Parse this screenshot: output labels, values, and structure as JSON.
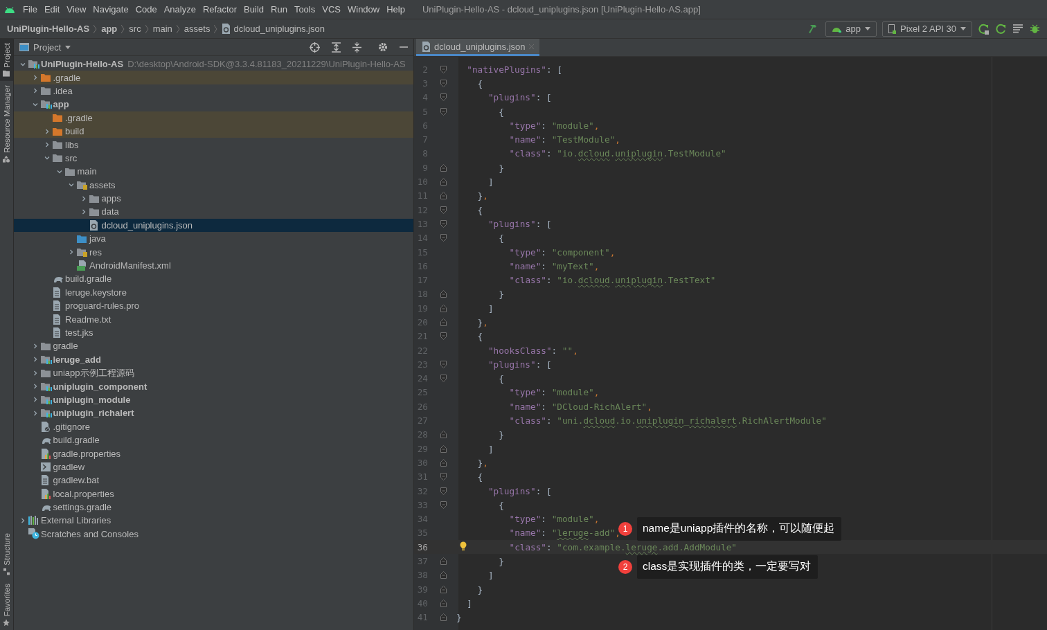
{
  "menu_bar": {
    "items": [
      "File",
      "Edit",
      "View",
      "Navigate",
      "Code",
      "Analyze",
      "Refactor",
      "Build",
      "Run",
      "Tools",
      "VCS",
      "Window",
      "Help"
    ],
    "title": "UniPlugin-Hello-AS - dcloud_uniplugins.json [UniPlugin-Hello-AS.app]"
  },
  "nav_bar": {
    "breadcrumbs": [
      {
        "label": "UniPlugin-Hello-AS",
        "bold": true,
        "kind": "text"
      },
      {
        "label": "app",
        "bold": true,
        "kind": "text"
      },
      {
        "label": "src",
        "bold": false,
        "kind": "text"
      },
      {
        "label": "main",
        "bold": false,
        "kind": "text"
      },
      {
        "label": "assets",
        "bold": false,
        "kind": "text"
      },
      {
        "label": "dcloud_uniplugins.json",
        "bold": false,
        "kind": "json"
      }
    ],
    "run_config": "app",
    "device": "Pixel 2 API 30"
  },
  "side_strip": {
    "top": [
      {
        "label": "Project",
        "selected": true
      },
      {
        "label": "Resource Manager",
        "selected": false
      }
    ],
    "bottom": [
      {
        "label": "Structure",
        "selected": false
      },
      {
        "label": "Favorites",
        "selected": false
      }
    ]
  },
  "project_panel": {
    "title": "Project",
    "tree": [
      {
        "label": "UniPlugin-Hello-AS",
        "path": "D:\\desktop\\Android-SDK@3.3.4.81183_20211229\\UniPlugin-Hello-AS",
        "kind": "module",
        "bold": true,
        "excluded": false,
        "selected": false,
        "expanded": true,
        "children": [
          {
            "label": ".gradle",
            "kind": "folder_excluded",
            "bold": false,
            "excluded": true,
            "selected": false,
            "expanded": false
          },
          {
            "label": ".idea",
            "kind": "folder",
            "bold": false,
            "excluded": false,
            "selected": false,
            "expanded": false
          },
          {
            "label": "app",
            "kind": "module",
            "bold": true,
            "excluded": false,
            "selected": false,
            "expanded": true,
            "children": [
              {
                "label": ".gradle",
                "kind": "folder_excluded",
                "bold": false,
                "excluded": true,
                "selected": false
              },
              {
                "label": "build",
                "kind": "folder_excluded",
                "bold": false,
                "excluded": true,
                "selected": false,
                "expanded": false
              },
              {
                "label": "libs",
                "kind": "folder",
                "bold": false,
                "excluded": false,
                "selected": false,
                "expanded": false
              },
              {
                "label": "src",
                "kind": "folder",
                "bold": false,
                "excluded": false,
                "selected": false,
                "expanded": true,
                "children": [
                  {
                    "label": "main",
                    "kind": "folder",
                    "bold": false,
                    "excluded": false,
                    "selected": false,
                    "expanded": true,
                    "children": [
                      {
                        "label": "assets",
                        "kind": "assets",
                        "bold": false,
                        "excluded": false,
                        "selected": false,
                        "expanded": true,
                        "children": [
                          {
                            "label": "apps",
                            "kind": "folder",
                            "bold": false,
                            "excluded": false,
                            "selected": false,
                            "expanded": false
                          },
                          {
                            "label": "data",
                            "kind": "folder",
                            "bold": false,
                            "excluded": false,
                            "selected": false,
                            "expanded": false
                          },
                          {
                            "label": "dcloud_uniplugins.json",
                            "kind": "json",
                            "bold": false,
                            "excluded": false,
                            "selected": true
                          }
                        ]
                      },
                      {
                        "label": "java",
                        "kind": "java",
                        "bold": false,
                        "excluded": false,
                        "selected": false
                      },
                      {
                        "label": "res",
                        "kind": "assets",
                        "bold": false,
                        "excluded": false,
                        "selected": false,
                        "expanded": false
                      },
                      {
                        "label": "AndroidManifest.xml",
                        "kind": "manifest",
                        "bold": false,
                        "excluded": false,
                        "selected": false
                      }
                    ]
                  }
                ]
              },
              {
                "label": "build.gradle",
                "kind": "gradle",
                "bold": false,
                "excluded": false,
                "selected": false
              },
              {
                "label": "leruge.keystore",
                "kind": "file",
                "bold": false,
                "excluded": false,
                "selected": false
              },
              {
                "label": "proguard-rules.pro",
                "kind": "file",
                "bold": false,
                "excluded": false,
                "selected": false
              },
              {
                "label": "Readme.txt",
                "kind": "file",
                "bold": false,
                "excluded": false,
                "selected": false
              },
              {
                "label": "test.jks",
                "kind": "file",
                "bold": false,
                "excluded": false,
                "selected": false
              }
            ]
          },
          {
            "label": "gradle",
            "kind": "folder",
            "bold": false,
            "excluded": false,
            "selected": false,
            "expanded": false
          },
          {
            "label": "leruge_add",
            "kind": "module",
            "bold": true,
            "excluded": false,
            "selected": false,
            "expanded": false
          },
          {
            "label": "uniapp示例工程源码",
            "kind": "folder",
            "bold": false,
            "excluded": false,
            "selected": false,
            "expanded": false
          },
          {
            "label": "uniplugin_component",
            "kind": "module",
            "bold": true,
            "excluded": false,
            "selected": false,
            "expanded": false
          },
          {
            "label": "uniplugin_module",
            "kind": "module",
            "bold": true,
            "excluded": false,
            "selected": false,
            "expanded": false
          },
          {
            "label": "uniplugin_richalert",
            "kind": "module",
            "bold": true,
            "excluded": false,
            "selected": false,
            "expanded": false
          },
          {
            "label": ".gitignore",
            "kind": "ignore",
            "bold": false,
            "excluded": false,
            "selected": false
          },
          {
            "label": "build.gradle",
            "kind": "gradle",
            "bold": false,
            "excluded": false,
            "selected": false
          },
          {
            "label": "gradle.properties",
            "kind": "properties",
            "bold": false,
            "excluded": false,
            "selected": false
          },
          {
            "label": "gradlew",
            "kind": "script",
            "bold": false,
            "excluded": false,
            "selected": false
          },
          {
            "label": "gradlew.bat",
            "kind": "file",
            "bold": false,
            "excluded": false,
            "selected": false
          },
          {
            "label": "local.properties",
            "kind": "properties",
            "bold": false,
            "excluded": false,
            "selected": false
          },
          {
            "label": "settings.gradle",
            "kind": "gradle",
            "bold": false,
            "excluded": false,
            "selected": false
          }
        ]
      },
      {
        "label": "External Libraries",
        "kind": "library",
        "bold": false,
        "excluded": false,
        "selected": false,
        "expanded": false
      },
      {
        "label": "Scratches and Consoles",
        "kind": "scratch",
        "bold": false,
        "excluded": false,
        "selected": false
      }
    ]
  },
  "editor": {
    "tabs": [
      {
        "label": "dcloud_uniplugins.json",
        "selected": true
      }
    ],
    "lines": [
      {
        "number": "2",
        "current": false,
        "tokens": [
          {
            "kind": "key",
            "text": "\"nativePlugins\""
          },
          {
            "kind": "punct",
            "text": ": ["
          }
        ]
      },
      {
        "number": "3",
        "current": false,
        "tokens": [
          {
            "kind": "punct",
            "text": "{"
          }
        ]
      },
      {
        "number": "4",
        "current": false,
        "tokens": [
          {
            "kind": "key",
            "text": "\"plugins\""
          },
          {
            "kind": "punct",
            "text": ": ["
          }
        ]
      },
      {
        "number": "5",
        "current": false,
        "tokens": [
          {
            "kind": "punct",
            "text": "{"
          }
        ]
      },
      {
        "number": "6",
        "current": false,
        "tokens": [
          {
            "kind": "key",
            "text": "\"type\""
          },
          {
            "kind": "punct",
            "text": ": "
          },
          {
            "kind": "string",
            "text": "\"module\""
          },
          {
            "kind": "comma",
            "text": ","
          }
        ]
      },
      {
        "number": "7",
        "current": false,
        "tokens": [
          {
            "kind": "key",
            "text": "\"name\""
          },
          {
            "kind": "punct",
            "text": ": "
          },
          {
            "kind": "string",
            "text": "\"TestModule\""
          },
          {
            "kind": "comma",
            "text": ","
          }
        ]
      },
      {
        "number": "8",
        "current": false,
        "tokens": [
          {
            "kind": "key",
            "text": "\"class\""
          },
          {
            "kind": "punct",
            "text": ": "
          },
          {
            "kind": "string",
            "text": "\"io."
          },
          {
            "kind": "typo",
            "text": "dcloud"
          },
          {
            "kind": "string",
            "text": "."
          },
          {
            "kind": "typo",
            "text": "uniplugin"
          },
          {
            "kind": "string",
            "text": ".TestModule\""
          }
        ]
      },
      {
        "number": "9",
        "current": false,
        "tokens": [
          {
            "kind": "punct",
            "text": "}"
          }
        ]
      },
      {
        "number": "10",
        "current": false,
        "tokens": [
          {
            "kind": "punct",
            "text": "]"
          }
        ]
      },
      {
        "number": "11",
        "current": false,
        "tokens": [
          {
            "kind": "punct",
            "text": "}"
          },
          {
            "kind": "comma",
            "text": ","
          }
        ]
      },
      {
        "number": "12",
        "current": false,
        "tokens": [
          {
            "kind": "punct",
            "text": "{"
          }
        ]
      },
      {
        "number": "13",
        "current": false,
        "tokens": [
          {
            "kind": "key",
            "text": "\"plugins\""
          },
          {
            "kind": "punct",
            "text": ": ["
          }
        ]
      },
      {
        "number": "14",
        "current": false,
        "tokens": [
          {
            "kind": "punct",
            "text": "{"
          }
        ]
      },
      {
        "number": "15",
        "current": false,
        "tokens": [
          {
            "kind": "key",
            "text": "\"type\""
          },
          {
            "kind": "punct",
            "text": ": "
          },
          {
            "kind": "string",
            "text": "\"component\""
          },
          {
            "kind": "comma",
            "text": ","
          }
        ]
      },
      {
        "number": "16",
        "current": false,
        "tokens": [
          {
            "kind": "key",
            "text": "\"name\""
          },
          {
            "kind": "punct",
            "text": ": "
          },
          {
            "kind": "string",
            "text": "\"myText\""
          },
          {
            "kind": "comma",
            "text": ","
          }
        ]
      },
      {
        "number": "17",
        "current": false,
        "tokens": [
          {
            "kind": "key",
            "text": "\"class\""
          },
          {
            "kind": "punct",
            "text": ": "
          },
          {
            "kind": "string",
            "text": "\"io."
          },
          {
            "kind": "typo",
            "text": "dcloud"
          },
          {
            "kind": "string",
            "text": "."
          },
          {
            "kind": "typo",
            "text": "uniplugin"
          },
          {
            "kind": "string",
            "text": ".TestText\""
          }
        ]
      },
      {
        "number": "18",
        "current": false,
        "tokens": [
          {
            "kind": "punct",
            "text": "}"
          }
        ]
      },
      {
        "number": "19",
        "current": false,
        "tokens": [
          {
            "kind": "punct",
            "text": "]"
          }
        ]
      },
      {
        "number": "20",
        "current": false,
        "tokens": [
          {
            "kind": "punct",
            "text": "}"
          },
          {
            "kind": "comma",
            "text": ","
          }
        ]
      },
      {
        "number": "21",
        "current": false,
        "tokens": [
          {
            "kind": "punct",
            "text": "{"
          }
        ]
      },
      {
        "number": "22",
        "current": false,
        "tokens": [
          {
            "kind": "key",
            "text": "\"hooksClass\""
          },
          {
            "kind": "punct",
            "text": ": "
          },
          {
            "kind": "string",
            "text": "\"\""
          },
          {
            "kind": "comma",
            "text": ","
          }
        ]
      },
      {
        "number": "23",
        "current": false,
        "tokens": [
          {
            "kind": "key",
            "text": "\"plugins\""
          },
          {
            "kind": "punct",
            "text": ": ["
          }
        ]
      },
      {
        "number": "24",
        "current": false,
        "tokens": [
          {
            "kind": "punct",
            "text": "{"
          }
        ]
      },
      {
        "number": "25",
        "current": false,
        "tokens": [
          {
            "kind": "key",
            "text": "\"type\""
          },
          {
            "kind": "punct",
            "text": ": "
          },
          {
            "kind": "string",
            "text": "\"module\""
          },
          {
            "kind": "comma",
            "text": ","
          }
        ]
      },
      {
        "number": "26",
        "current": false,
        "tokens": [
          {
            "kind": "key",
            "text": "\"name\""
          },
          {
            "kind": "punct",
            "text": ": "
          },
          {
            "kind": "string",
            "text": "\"DCloud-RichAlert\""
          },
          {
            "kind": "comma",
            "text": ","
          }
        ]
      },
      {
        "number": "27",
        "current": false,
        "tokens": [
          {
            "kind": "key",
            "text": "\"class\""
          },
          {
            "kind": "punct",
            "text": ": "
          },
          {
            "kind": "string",
            "text": "\"uni."
          },
          {
            "kind": "typo",
            "text": "dcloud"
          },
          {
            "kind": "string",
            "text": ".io."
          },
          {
            "kind": "typo",
            "text": "uniplugin"
          },
          {
            "kind": "string",
            "text": "_"
          },
          {
            "kind": "typo",
            "text": "richalert"
          },
          {
            "kind": "string",
            "text": ".RichAlertModule\""
          }
        ]
      },
      {
        "number": "28",
        "current": false,
        "tokens": [
          {
            "kind": "punct",
            "text": "}"
          }
        ]
      },
      {
        "number": "29",
        "current": false,
        "tokens": [
          {
            "kind": "punct",
            "text": "]"
          }
        ]
      },
      {
        "number": "30",
        "current": false,
        "tokens": [
          {
            "kind": "punct",
            "text": "}"
          },
          {
            "kind": "comma",
            "text": ","
          }
        ]
      },
      {
        "number": "31",
        "current": false,
        "tokens": [
          {
            "kind": "punct",
            "text": "{"
          }
        ]
      },
      {
        "number": "32",
        "current": false,
        "tokens": [
          {
            "kind": "key",
            "text": "\"plugins\""
          },
          {
            "kind": "punct",
            "text": ": ["
          }
        ]
      },
      {
        "number": "33",
        "current": false,
        "tokens": [
          {
            "kind": "punct",
            "text": "{"
          }
        ]
      },
      {
        "number": "34",
        "current": false,
        "tokens": [
          {
            "kind": "key",
            "text": "\"type\""
          },
          {
            "kind": "punct",
            "text": ": "
          },
          {
            "kind": "string",
            "text": "\"module\""
          },
          {
            "kind": "comma",
            "text": ","
          }
        ]
      },
      {
        "number": "35",
        "current": false,
        "tokens": [
          {
            "kind": "key",
            "text": "\"name\""
          },
          {
            "kind": "punct",
            "text": ": "
          },
          {
            "kind": "string",
            "text": "\""
          },
          {
            "kind": "typo",
            "text": "leruge"
          },
          {
            "kind": "string",
            "text": "-add\""
          },
          {
            "kind": "comma",
            "text": ","
          }
        ],
        "callout": {
          "badge": "1",
          "text": "name是uniapp插件的名称，可以随便起"
        }
      },
      {
        "number": "36",
        "current": true,
        "bulb": true,
        "tokens": [
          {
            "kind": "key",
            "text": "\"class\""
          },
          {
            "kind": "punct",
            "text": ": "
          },
          {
            "kind": "string",
            "text": "\"com.example."
          },
          {
            "kind": "typo",
            "text": "leruge"
          },
          {
            "kind": "string",
            "text": ".add.AddModule\""
          }
        ]
      },
      {
        "number": "37",
        "current": false,
        "tokens": [
          {
            "kind": "punct",
            "text": "}"
          }
        ],
        "callout": {
          "badge": "2",
          "text": "class是实现插件的类，一定要写对"
        }
      },
      {
        "number": "38",
        "current": false,
        "tokens": [
          {
            "kind": "punct",
            "text": "]"
          }
        ]
      },
      {
        "number": "39",
        "current": false,
        "tokens": [
          {
            "kind": "punct",
            "text": "}"
          }
        ]
      },
      {
        "number": "40",
        "current": false,
        "tokens": [
          {
            "kind": "punct",
            "text": "]"
          }
        ]
      },
      {
        "number": "41",
        "current": false,
        "tokens": [
          {
            "kind": "punct",
            "text": "}"
          }
        ]
      }
    ]
  }
}
